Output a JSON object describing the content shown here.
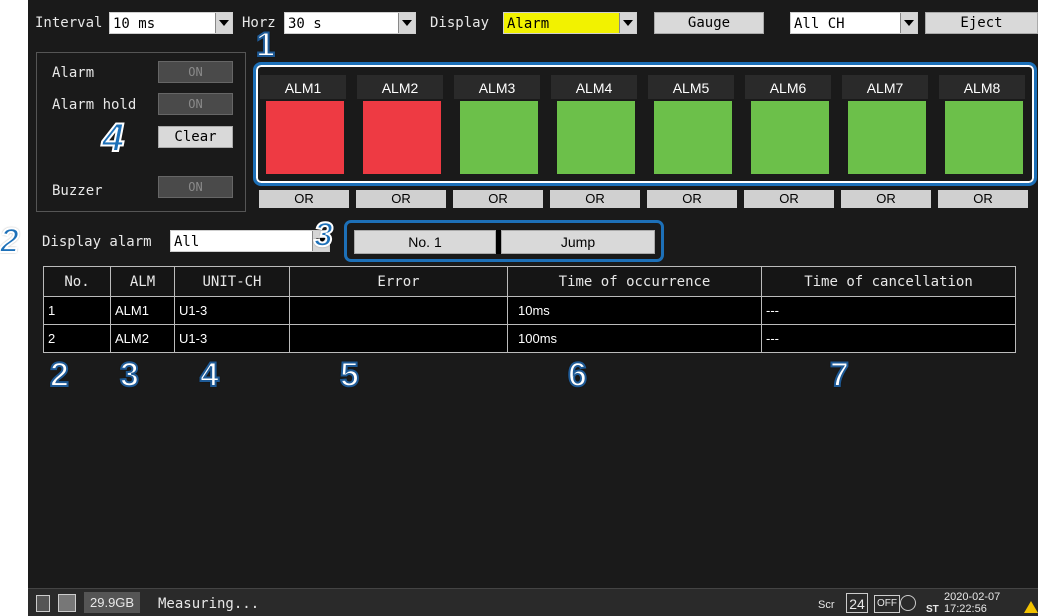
{
  "toolbar": {
    "interval_label": "Interval",
    "interval_value": "10 ms",
    "horz_label": "Horz",
    "horz_value": "30 s",
    "display_label": "Display",
    "display_value": "Alarm",
    "gauge_label": "Gauge",
    "channel_value": "All CH",
    "eject_label": "Eject"
  },
  "alarm_settings": {
    "alarm_label": "Alarm",
    "alarm_state": "ON",
    "alarm_hold_label": "Alarm hold",
    "alarm_hold_state": "ON",
    "clear_label": "Clear",
    "buzzer_label": "Buzzer",
    "buzzer_state": "ON"
  },
  "alarm_channels": [
    {
      "label": "ALM1",
      "logic": "OR",
      "status": "active",
      "color": "#ee3a43"
    },
    {
      "label": "ALM2",
      "logic": "OR",
      "status": "active",
      "color": "#ee3a43"
    },
    {
      "label": "ALM3",
      "logic": "OR",
      "status": "normal",
      "color": "#6cc04a"
    },
    {
      "label": "ALM4",
      "logic": "OR",
      "status": "normal",
      "color": "#6cc04a"
    },
    {
      "label": "ALM5",
      "logic": "OR",
      "status": "normal",
      "color": "#6cc04a"
    },
    {
      "label": "ALM6",
      "logic": "OR",
      "status": "normal",
      "color": "#6cc04a"
    },
    {
      "label": "ALM7",
      "logic": "OR",
      "status": "normal",
      "color": "#6cc04a"
    },
    {
      "label": "ALM8",
      "logic": "OR",
      "status": "normal",
      "color": "#6cc04a"
    }
  ],
  "display_alarm": {
    "label": "Display alarm",
    "value": "All"
  },
  "jump": {
    "number": "No. 1",
    "button_label": "Jump"
  },
  "table": {
    "headers": [
      "No.",
      "ALM",
      "UNIT-CH",
      "Error",
      "Time of occurrence",
      "Time of cancellation"
    ],
    "rows": [
      [
        "1",
        "ALM1",
        "U1-3",
        "",
        "10ms",
        "---"
      ],
      [
        "2",
        "ALM2",
        "U1-3",
        "",
        "100ms",
        "---"
      ]
    ]
  },
  "callouts": {
    "c1": "1",
    "c2": "2",
    "c3": "3",
    "c4": "4",
    "r2": "2",
    "r3": "3",
    "r4": "4",
    "r5": "5",
    "r6": "6",
    "r7": "7"
  },
  "status_bar": {
    "storage": "29.9GB",
    "state": "Measuring...",
    "scr_label": "Scr",
    "page_num": "24",
    "off_label": "OFF",
    "st_label": "ST",
    "date": "2020-02-07",
    "time": "17:22:56"
  },
  "colors": {
    "alarm_active": "#ee3a43",
    "alarm_normal": "#6cc04a",
    "highlight_yellow": "#f2f200",
    "callout_frame": "#1d70b8"
  }
}
